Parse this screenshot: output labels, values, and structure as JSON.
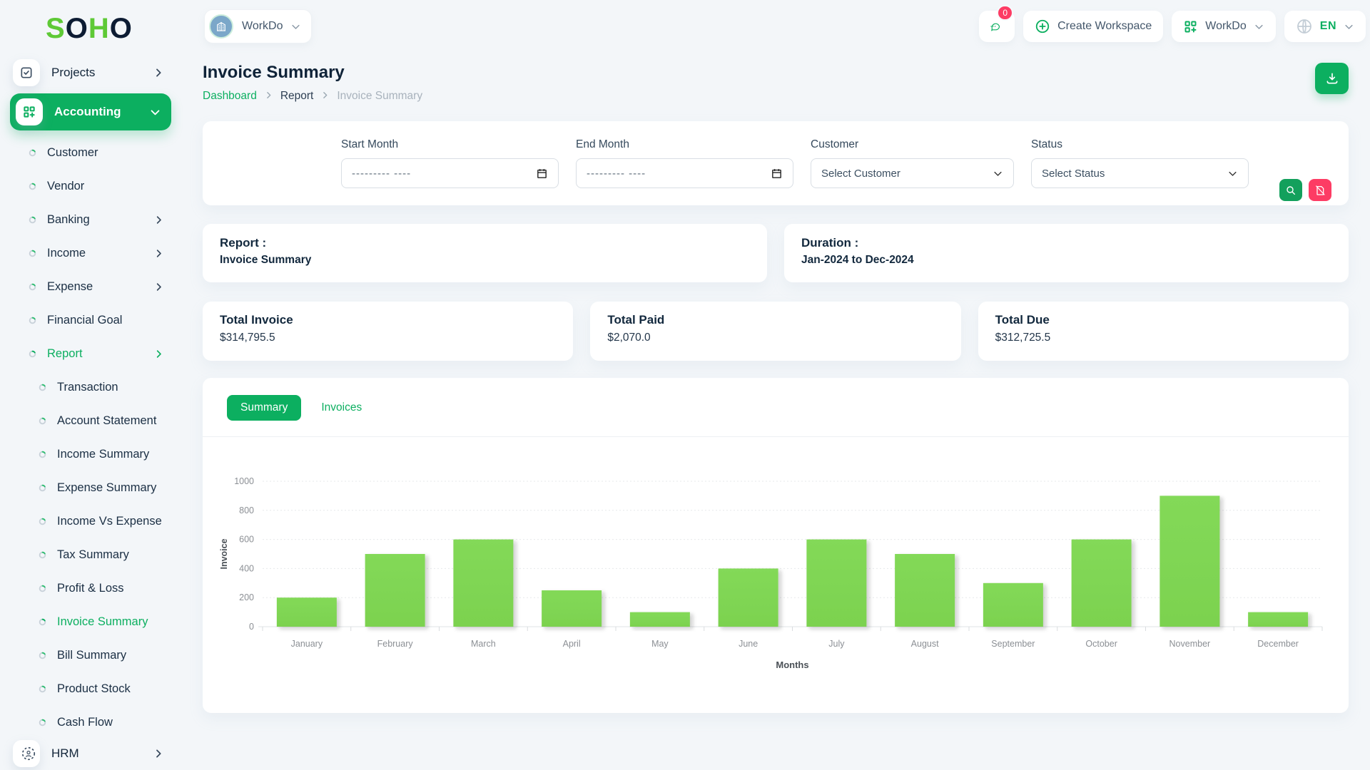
{
  "colors": {
    "brand_green": "#0caf60",
    "bar_green": "#7cd24f",
    "danger_pink": "#fd3c64",
    "logo_green": "#5ec936",
    "logo_dark": "#0d1c33"
  },
  "brand": {
    "logo_letters": [
      "S",
      "O",
      "H",
      "O"
    ]
  },
  "sidebar": {
    "items": [
      {
        "label": "Projects",
        "type": "top",
        "icon": "checkbox-icon",
        "chevron": "right"
      },
      {
        "label": "Accounting",
        "type": "top-active",
        "icon": "grid-plus-icon",
        "chevron": "down"
      },
      {
        "label": "Customer",
        "type": "sub"
      },
      {
        "label": "Vendor",
        "type": "sub"
      },
      {
        "label": "Banking",
        "type": "sub",
        "chevron": "right"
      },
      {
        "label": "Income",
        "type": "sub",
        "chevron": "right"
      },
      {
        "label": "Expense",
        "type": "sub",
        "chevron": "right"
      },
      {
        "label": "Financial Goal",
        "type": "sub"
      },
      {
        "label": "Report",
        "type": "sub",
        "chevron": "right",
        "active": true
      },
      {
        "label": "Transaction",
        "type": "sub2"
      },
      {
        "label": "Account Statement",
        "type": "sub2"
      },
      {
        "label": "Income Summary",
        "type": "sub2"
      },
      {
        "label": "Expense Summary",
        "type": "sub2"
      },
      {
        "label": "Income Vs Expense",
        "type": "sub2"
      },
      {
        "label": "Tax Summary",
        "type": "sub2"
      },
      {
        "label": "Profit & Loss",
        "type": "sub2"
      },
      {
        "label": "Invoice Summary",
        "type": "sub2",
        "active": true
      },
      {
        "label": "Bill Summary",
        "type": "sub2"
      },
      {
        "label": "Product Stock",
        "type": "sub2"
      },
      {
        "label": "Cash Flow",
        "type": "sub2"
      }
    ],
    "bottom_item": {
      "label": "HRM",
      "icon": "user-focus-icon",
      "chevron": "right"
    }
  },
  "header": {
    "workspace": {
      "label": "WorkDo"
    },
    "messages": {
      "badge": "0"
    },
    "create_workspace": "Create Workspace",
    "workdo_menu": "WorkDo",
    "language": "EN"
  },
  "page": {
    "title": "Invoice Summary",
    "breadcrumb": [
      {
        "label": "Dashboard",
        "style": "link"
      },
      {
        "label": "Report",
        "style": "mid"
      },
      {
        "label": "Invoice Summary",
        "style": "current"
      }
    ]
  },
  "filters": {
    "start_month": {
      "label": "Start Month",
      "placeholder": "--------- ----"
    },
    "end_month": {
      "label": "End Month",
      "placeholder": "--------- ----"
    },
    "customer": {
      "label": "Customer",
      "value": "Select Customer"
    },
    "status": {
      "label": "Status",
      "value": "Select Status"
    }
  },
  "info_cards": {
    "report": {
      "title": "Report :",
      "value": "Invoice Summary"
    },
    "duration": {
      "title": "Duration :",
      "value": "Jan-2024 to Dec-2024"
    }
  },
  "totals": [
    {
      "label": "Total Invoice",
      "value": "$314,795.5"
    },
    {
      "label": "Total Paid",
      "value": "$2,070.0"
    },
    {
      "label": "Total Due",
      "value": "$312,725.5"
    }
  ],
  "tabs": [
    {
      "label": "Summary",
      "active": true
    },
    {
      "label": "Invoices",
      "active": false
    }
  ],
  "chart_data": {
    "type": "bar",
    "title": "",
    "categories": [
      "January",
      "February",
      "March",
      "April",
      "May",
      "June",
      "July",
      "August",
      "September",
      "October",
      "November",
      "December"
    ],
    "values": [
      200,
      500,
      600,
      250,
      100,
      400,
      600,
      500,
      300,
      600,
      900,
      100
    ],
    "xlabel": "Months",
    "ylabel": "Invoice",
    "ylim": [
      0,
      1000
    ],
    "ytick_step": 200,
    "grid": true,
    "legend": false,
    "bar_color": "#7cd24f"
  }
}
